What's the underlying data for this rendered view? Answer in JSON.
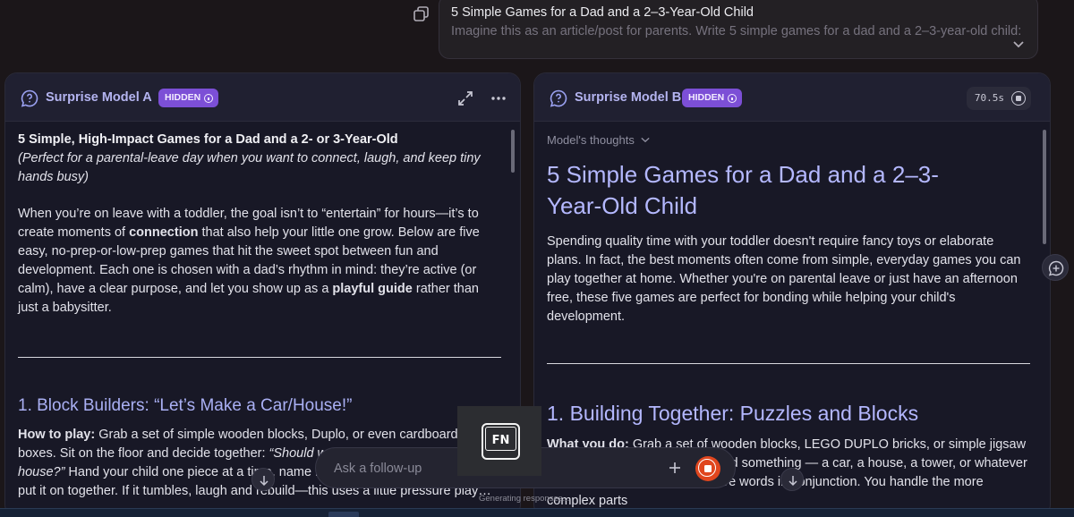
{
  "prompt": {
    "title": "5 Simple Games for a Dad and a 2–3-Year-Old Child",
    "text": "Imagine this as an article/post for parents. Write 5 simple games for a dad and a 2–3-year-old child:"
  },
  "panel_a": {
    "model_name": "Surprise Model A",
    "badge": "HIDDEN",
    "title": "5 Simple, High-Impact Games for a Dad and a 2- or 3-Year-Old",
    "subtitle": "(Perfect for a parental-leave day when you want to connect, laugh, and keep tiny hands busy)",
    "intro": {
      "p1": "When you’re on leave with a toddler, the goal isn’t to “entertain” for hours—it’s to create moments of ",
      "b1": "connection",
      "p2": " that also help your little one grow. Below are five easy, no-prep-or-low-prep games that hit the sweet spot between fun and development. Each one is chosen with a dad’s rhythm in mind: they’re active (or calm), have a clear purpose, and let you show up as a ",
      "b2": "playful guide",
      "p3": " rather than just a babysitter."
    },
    "section1": {
      "heading": "1. Block Builders: “Let’s Make a Car/House!”",
      "label": "How to play:",
      "t1": " Grab a set of simple wooden blocks, Duplo, or even cardboard boxes. Sit on the floor and decide together: ",
      "quote": "“Should we build a red car or a tall house?”",
      "t2": " Hand your child one piece at a time, name it (“Here’s a red block!”), and put it on together. If it tumbles, laugh and rebuild—this uses a little pressure play…"
    }
  },
  "panel_b": {
    "model_name": "Surprise Model B",
    "badge": "HIDDEN",
    "timer": "70.5s",
    "thoughts_label": "Model's thoughts",
    "title": "5 Simple Games for a Dad and a 2–3-Year-Old Child",
    "intro": "Spending quality time with your toddler doesn't require fancy toys or elaborate plans. In fact, the best moments often come from simple, everyday games you can play together at home. Whether you're on parental leave or just have an afternoon free, these five games are perfect for bonding while helping your child's development.",
    "section1": {
      "heading": "1. Building Together: Puzzles and Blocks",
      "label": "What you do:",
      "text": " Grab a set of wooden blocks, LEGO DUPLO bricks, or simple jigsaw puzzles. Sit on the floor and build something — a car, a house, a tower, or whatever your child wants. Use descriptive words in conjunction. You handle the more complex parts"
    }
  },
  "composer": {
    "placeholder": "Ask a follow-up"
  },
  "fn_key_label": "FN",
  "status": "Generating responses..."
}
